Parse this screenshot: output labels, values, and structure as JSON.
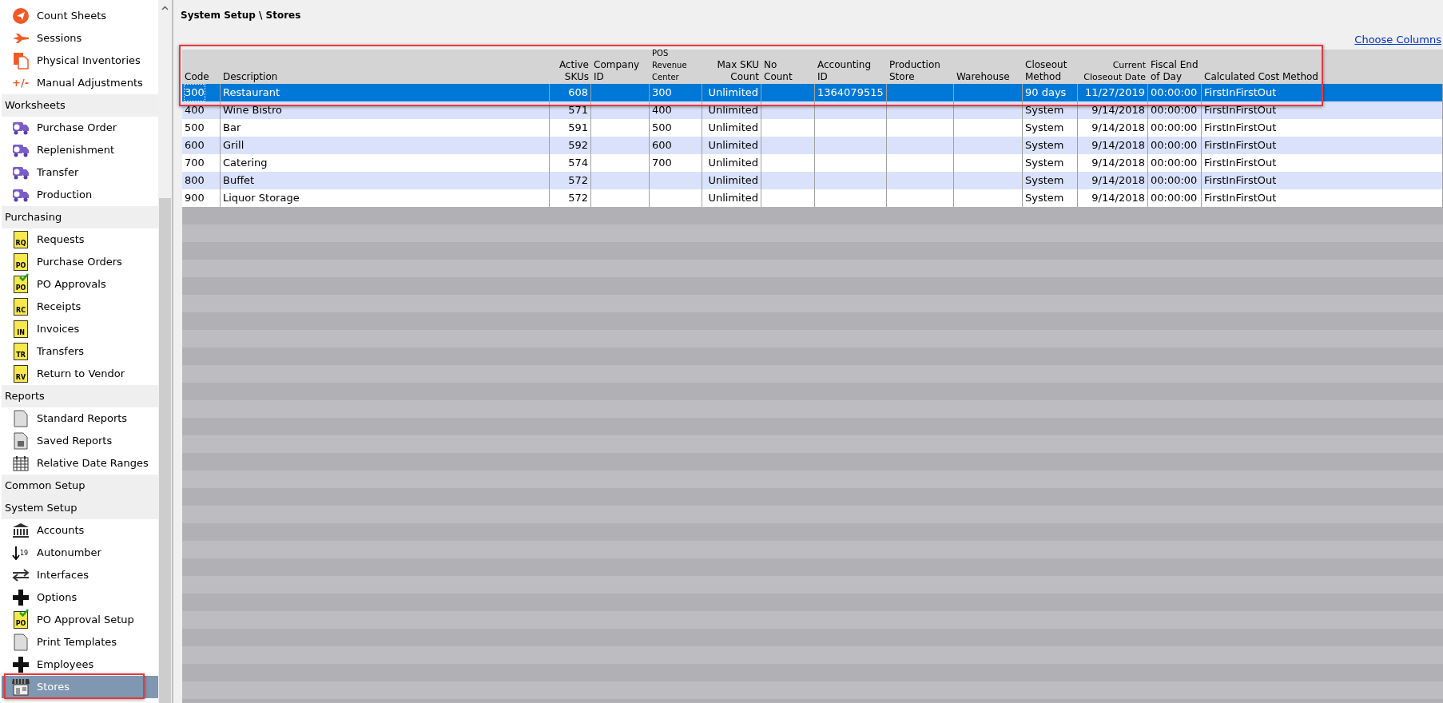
{
  "sidebar": {
    "sections": [
      {
        "items": [
          {
            "label": "Count Sheets",
            "kind": "send",
            "selected": false
          },
          {
            "label": "Sessions",
            "kind": "plane",
            "selected": false
          },
          {
            "label": "Physical Inventories",
            "kind": "pages",
            "selected": false
          },
          {
            "label": "Manual Adjustments",
            "kind": "plusminus",
            "icon_text": "+/-",
            "selected": false
          }
        ]
      },
      {
        "title": "Worksheets",
        "items": [
          {
            "label": "Purchase Order",
            "kind": "truck",
            "selected": false
          },
          {
            "label": "Replenishment",
            "kind": "truck",
            "selected": false
          },
          {
            "label": "Transfer",
            "kind": "truck",
            "selected": false
          },
          {
            "label": "Production",
            "kind": "truck",
            "selected": false
          }
        ]
      },
      {
        "title": "Purchasing",
        "items": [
          {
            "label": "Requests",
            "kind": "doc",
            "icon_text": "RQ",
            "selected": false
          },
          {
            "label": "Purchase Orders",
            "kind": "doc",
            "icon_text": "PO",
            "selected": false
          },
          {
            "label": "PO Approvals",
            "kind": "approval",
            "icon_text": "PO",
            "selected": false
          },
          {
            "label": "Receipts",
            "kind": "doc",
            "icon_text": "RC",
            "selected": false
          },
          {
            "label": "Invoices",
            "kind": "doc",
            "icon_text": "IN",
            "selected": false
          },
          {
            "label": "Transfers",
            "kind": "doc",
            "icon_text": "TR",
            "selected": false
          },
          {
            "label": "Return to Vendor",
            "kind": "doc",
            "icon_text": "RV",
            "selected": false
          }
        ]
      },
      {
        "title": "Reports",
        "items": [
          {
            "label": "Standard Reports",
            "kind": "report",
            "selected": false
          },
          {
            "label": "Saved Reports",
            "kind": "saved",
            "selected": false
          },
          {
            "label": "Relative Date Ranges",
            "kind": "calendar",
            "selected": false
          }
        ]
      },
      {
        "title": "Common Setup"
      },
      {
        "title": "System Setup",
        "items": [
          {
            "label": "Accounts",
            "kind": "bank",
            "selected": false
          },
          {
            "label": "Autonumber",
            "kind": "sort",
            "icon_text": "19",
            "selected": false
          },
          {
            "label": "Interfaces",
            "kind": "arrows",
            "selected": false
          },
          {
            "label": "Options",
            "kind": "plus",
            "selected": false
          },
          {
            "label": "PO Approval Setup",
            "kind": "approval",
            "icon_text": "PO",
            "selected": false
          },
          {
            "label": "Print Templates",
            "kind": "report",
            "selected": false
          },
          {
            "label": "Employees",
            "kind": "plus",
            "selected": false
          },
          {
            "label": "Stores",
            "kind": "store",
            "selected": true
          }
        ]
      }
    ]
  },
  "breadcrumb": "System Setup \\ Stores",
  "choose_columns_link": "Choose Columns",
  "table": {
    "columns": [
      "Code",
      "Description",
      "Active\nSKUs",
      "Company\nID",
      "POS\nRevenue\nCenter",
      "Max SKU\nCount",
      "No\nCount",
      "Accounting\nID",
      "Production\nStore",
      "Warehouse",
      "Closeout\nMethod",
      "Current\nCloseout Date",
      "Fiscal End\nof Day",
      "Calculated Cost Method"
    ],
    "rows": [
      {
        "selected": true,
        "cells": [
          "300",
          "Restaurant",
          "608",
          "",
          "300",
          "Unlimited",
          "",
          "1364079515",
          "",
          "",
          "90 days",
          "11/27/2019",
          "00:00:00",
          "FirstInFirstOut"
        ]
      },
      {
        "selected": false,
        "cells": [
          "400",
          "Wine Bistro",
          "571",
          "",
          "400",
          "Unlimited",
          "",
          "",
          "",
          "",
          "System",
          "9/14/2018",
          "00:00:00",
          "FirstInFirstOut"
        ]
      },
      {
        "selected": false,
        "cells": [
          "500",
          "Bar",
          "591",
          "",
          "500",
          "Unlimited",
          "",
          "",
          "",
          "",
          "System",
          "9/14/2018",
          "00:00:00",
          "FirstInFirstOut"
        ]
      },
      {
        "selected": false,
        "cells": [
          "600",
          "Grill",
          "592",
          "",
          "600",
          "Unlimited",
          "",
          "",
          "",
          "",
          "System",
          "9/14/2018",
          "00:00:00",
          "FirstInFirstOut"
        ]
      },
      {
        "selected": false,
        "cells": [
          "700",
          "Catering",
          "574",
          "",
          "700",
          "Unlimited",
          "",
          "",
          "",
          "",
          "System",
          "9/14/2018",
          "00:00:00",
          "FirstInFirstOut"
        ]
      },
      {
        "selected": false,
        "cells": [
          "800",
          "Buffet",
          "572",
          "",
          "",
          "Unlimited",
          "",
          "",
          "",
          "",
          "System",
          "9/14/2018",
          "00:00:00",
          "FirstInFirstOut"
        ]
      },
      {
        "selected": false,
        "cells": [
          "900",
          "Liquor Storage",
          "572",
          "",
          "",
          "Unlimited",
          "",
          "",
          "",
          "",
          "System",
          "9/14/2018",
          "00:00:00",
          "FirstInFirstOut"
        ]
      }
    ]
  }
}
